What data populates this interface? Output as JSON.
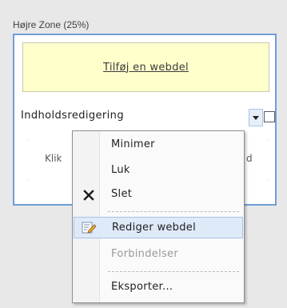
{
  "zone": {
    "title": "Højre Zone (25%)",
    "add_webpart_link": "Tilføj en webdel"
  },
  "webpart": {
    "title": "Indholdsredigering",
    "body_left": "Klik",
    "body_right": "d"
  },
  "menu": {
    "items": [
      {
        "label": "Minimer",
        "icon": "",
        "state": "normal"
      },
      {
        "label": "Luk",
        "icon": "",
        "state": "normal"
      },
      {
        "label": "Slet",
        "icon": "delete-x-icon",
        "state": "normal"
      },
      {
        "label": "Rediger webdel",
        "icon": "edit-webpart-icon",
        "state": "selected"
      },
      {
        "label": "Forbindelser",
        "icon": "",
        "state": "disabled"
      },
      {
        "label": "Eksporter...",
        "icon": "",
        "state": "normal"
      }
    ]
  },
  "colors": {
    "zone_border": "#6f9dd9",
    "add_webpart_background": "#ffffcc",
    "selected_item_background": "#dfeaf8"
  }
}
